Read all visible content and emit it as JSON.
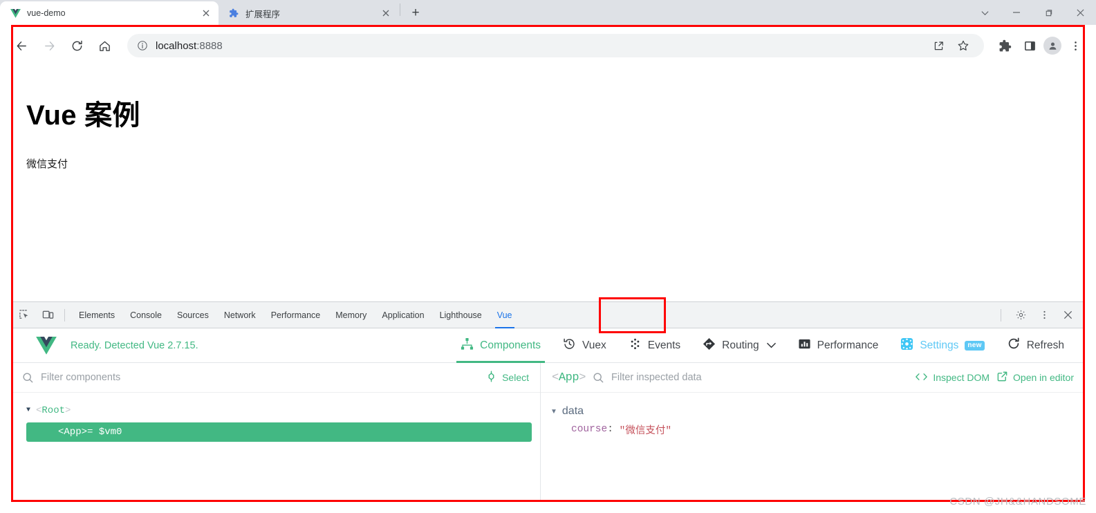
{
  "window": {
    "controls": [
      {
        "name": "tab-search-button",
        "icon": "chevron-down-icon"
      },
      {
        "name": "minimize-button",
        "icon": "minimize-icon"
      },
      {
        "name": "maximize-button",
        "icon": "maximize-icon"
      },
      {
        "name": "close-button",
        "icon": "close-icon"
      }
    ]
  },
  "tabs": [
    {
      "title": "vue-demo",
      "favicon": "vue-logo-icon",
      "active": true
    },
    {
      "title": "扩展程序",
      "favicon": "puzzle-icon",
      "active": false
    }
  ],
  "newtab_label": "+",
  "toolbar": {
    "back_icon": "back-arrow-icon",
    "forward_icon": "forward-arrow-icon",
    "reload_icon": "reload-icon",
    "home_icon": "home-icon",
    "url_host": "localhost",
    "url_port": ":8888",
    "site_info_icon": "info-circle-icon",
    "share_icon": "share-icon",
    "bookmark_icon": "star-icon",
    "extensions_icon": "puzzle-icon",
    "sidepanel_icon": "side-panel-icon",
    "profile_icon": "avatar-icon",
    "menu_icon": "three-dots-vertical-icon"
  },
  "page": {
    "heading": "Vue 案例",
    "paragraph": "微信支付"
  },
  "devtools": {
    "inspect_icon": "inspect-element-icon",
    "device_icon": "device-toolbar-icon",
    "tabs": [
      {
        "label": "Elements",
        "active": false
      },
      {
        "label": "Console",
        "active": false
      },
      {
        "label": "Sources",
        "active": false
      },
      {
        "label": "Network",
        "active": false
      },
      {
        "label": "Performance",
        "active": false
      },
      {
        "label": "Memory",
        "active": false
      },
      {
        "label": "Application",
        "active": false
      },
      {
        "label": "Lighthouse",
        "active": false
      },
      {
        "label": "Vue",
        "active": true
      }
    ],
    "settings_icon": "gear-icon",
    "more_icon": "three-dots-vertical-icon",
    "close_icon": "close-icon"
  },
  "vue_devtools": {
    "logo": "vue-logo-icon",
    "status": "Ready. Detected Vue 2.7.15.",
    "nav": [
      {
        "label": "Components",
        "icon": "components-tree-icon",
        "active": true
      },
      {
        "label": "Vuex",
        "icon": "vuex-history-icon",
        "active": false
      },
      {
        "label": "Events",
        "icon": "events-dots-icon",
        "active": false
      },
      {
        "label": "Routing",
        "icon": "routing-arrow-icon",
        "active": false,
        "has_dropdown": true
      },
      {
        "label": "Performance",
        "icon": "performance-bars-icon",
        "active": false
      },
      {
        "label": "Settings",
        "icon": "settings-gear-icon",
        "active": false,
        "badge": "new"
      },
      {
        "label": "Refresh",
        "icon": "refresh-icon",
        "active": false
      }
    ],
    "components_pane": {
      "filter_placeholder": "Filter components",
      "search_icon": "search-icon",
      "select_label": "Select",
      "select_icon": "crosshair-icon",
      "tree": [
        {
          "label": "Root",
          "selected": false,
          "expanded": true,
          "suffix": ""
        },
        {
          "label": "App",
          "selected": true,
          "expanded": false,
          "suffix": " = $vm0"
        }
      ]
    },
    "inspector_pane": {
      "component_name": "App",
      "filter_placeholder": "Filter inspected data",
      "search_icon": "search-icon",
      "inspect_dom_label": "Inspect DOM",
      "inspect_dom_icon": "code-brackets-icon",
      "open_editor_label": "Open in editor",
      "open_editor_icon": "external-link-icon",
      "groups": [
        {
          "name": "data",
          "expanded": true,
          "props": [
            {
              "key": "course",
              "value": "\"微信支付\""
            }
          ]
        }
      ]
    }
  },
  "watermark": "CSDN @JH&&HANDSOME",
  "colors": {
    "vue_green": "#42b883",
    "devtools_blue": "#1a73e8",
    "settings_blue": "#5ec8f5",
    "annotation_red": "#fe0000",
    "prop_name_purple": "#a0639e",
    "prop_string_red": "#c5515b"
  }
}
